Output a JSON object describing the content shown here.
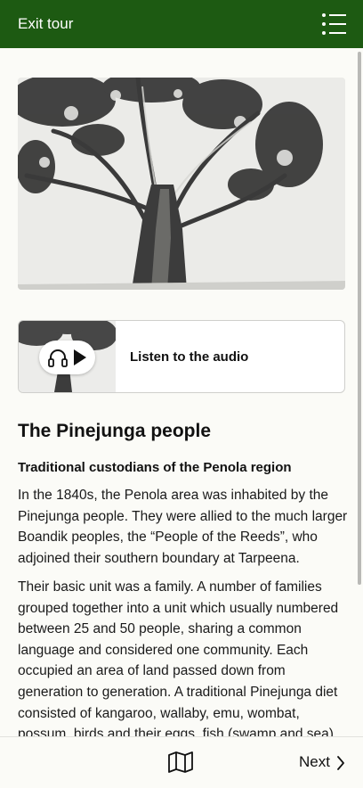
{
  "header": {
    "exit_label": "Exit tour",
    "menu_icon": "list-menu-icon",
    "background": "#1d5a12"
  },
  "hero_image": {
    "subject": "tree photograph",
    "style": "black-and-white"
  },
  "audio": {
    "label": "Listen to the audio",
    "icons": [
      "headphones-icon",
      "play-icon"
    ]
  },
  "article": {
    "title": "The Pinejunga people",
    "subtitle": "Traditional custodians of the Penola region",
    "paragraphs": [
      "In the 1840s, the Penola area was inhabited by the Pinejunga people. They were allied to the much larger Boandik peoples, the “People of the Reeds”, who adjoined their southern boundary at Tarpeena.",
      "Their basic unit was a family. A number of families grouped together into a unit which usually numbered between 25 and 50 people, sharing a common language and considered one community. Each occupied an area of land passed down from generation to generation. A traditional Pinejunga diet consisted of kangaroo, wallaby, emu, wombat, possum, birds and their eggs, fish (swamp and sea)"
    ]
  },
  "footer": {
    "map_icon": "map-icon",
    "next_label": "Next",
    "next_icon": "chevron-right-icon"
  }
}
